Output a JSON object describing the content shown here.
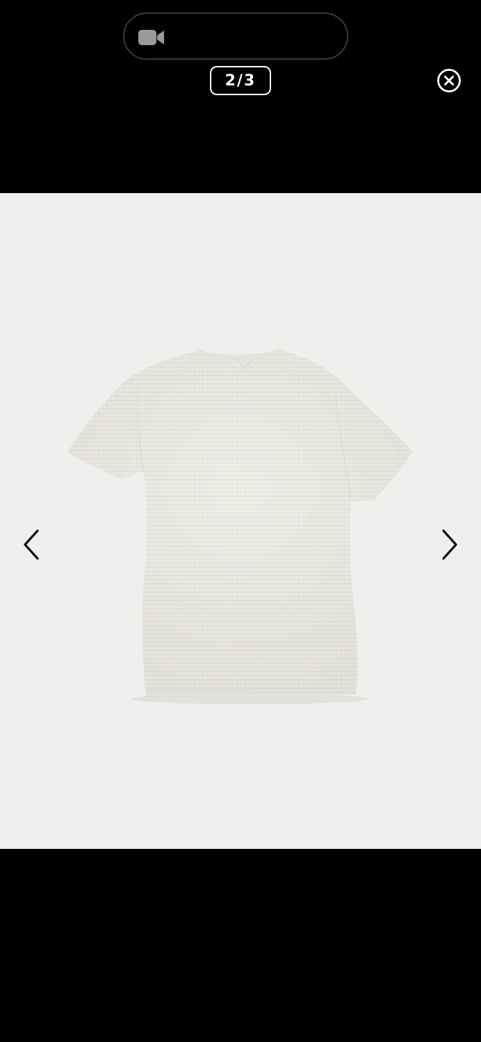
{
  "top_bar": {
    "call_indicator": {
      "icon": "video-camera-icon"
    },
    "counter": "2/3",
    "close": {
      "icon": "close-circle-icon"
    }
  },
  "viewer": {
    "image": {
      "subject": "t-shirt-back-view"
    },
    "prev": {
      "icon": "chevron-left-icon"
    },
    "next": {
      "icon": "chevron-right-icon"
    }
  },
  "colors": {
    "background": "#000000",
    "viewer_background": "#f0efed",
    "shirt": "#ecebe3",
    "icon_grey": "#9a9a9a"
  }
}
